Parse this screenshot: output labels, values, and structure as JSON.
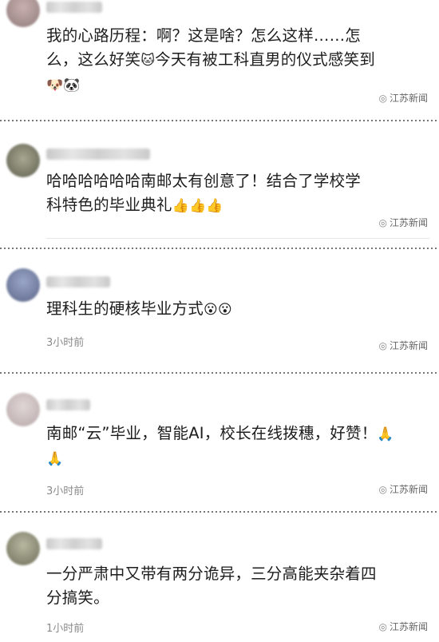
{
  "comments": [
    {
      "text": "我的心路历程：啊？这是啥？怎么这样……怎么，这么好笑🐱今天有被工科直男的仪式感笑到🐶🐼",
      "line1": "我的心路历程：啊？这是啥？怎么这样……怎",
      "line2": "么，这么好笑",
      "line2_emoji": "🐱",
      "line2_rest": "今天有被工科直男的仪式感笑到",
      "line3_emoji": "🐶🐼",
      "watermark": "江苏新闻",
      "avatar_color": "#b49a9a"
    },
    {
      "line1": "哈哈哈哈哈哈南邮太有创意了！结合了学校学",
      "line2": "科特色的毕业典礼",
      "line2_emoji": "👍👍👍",
      "watermark": "江苏新闻",
      "avatar_color": "#8c8c7a"
    },
    {
      "line1": "理科生的硬核毕业方式",
      "line1_emoji": "😮😮",
      "time": "3小时前",
      "watermark": "江苏新闻",
      "avatar_color": "#7a86a8"
    },
    {
      "line1": "南邮“云”毕业，智能AI，校长在线拨穗，好赞！",
      "line1_emoji": "🙏",
      "line2_emoji": "🙏",
      "time": "3小时前",
      "watermark": "江苏新闻",
      "avatar_color": "#d0c4c4"
    },
    {
      "line1": "一分严肃中又带有两分诡异，三分高能夹杂着四",
      "line2": "分搞笑。",
      "time": "1小时前",
      "watermark": "江苏新闻",
      "avatar_color": "#9a9a8a"
    }
  ]
}
